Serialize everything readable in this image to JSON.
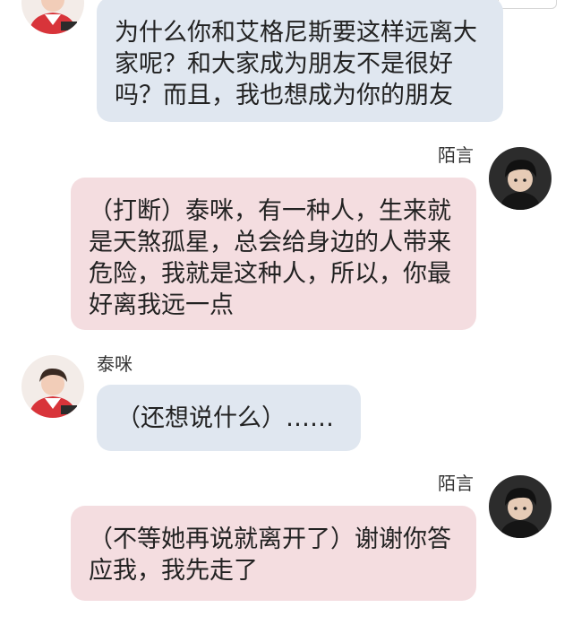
{
  "contacts": {
    "taimi": {
      "name": "泰咪"
    },
    "moyan": {
      "name": "陌言"
    }
  },
  "messages": [
    {
      "sender": "泰咪",
      "lines": [
        "为什么你和艾格尼斯要这样远离大",
        "家呢？和大家成为朋友不是很好",
        "吗？而且，我也想成为你的朋友"
      ]
    },
    {
      "sender": "陌言",
      "lines": [
        "（打断）泰咪，有一种人，生来就",
        "是天煞孤星，总会给身边的人带来",
        "危险，我就是这种人，所以，你最",
        "好离我远一点"
      ]
    },
    {
      "sender": "泰咪",
      "lines": [
        "（还想说什么）……"
      ]
    },
    {
      "sender": "陌言",
      "lines": [
        "（不等她再说就离开了）谢谢你答",
        "应我，我先走了"
      ]
    }
  ],
  "colors": {
    "incoming_bubble": "#e0e7f0",
    "outgoing_bubble": "#f4dde0",
    "text": "#222222"
  }
}
